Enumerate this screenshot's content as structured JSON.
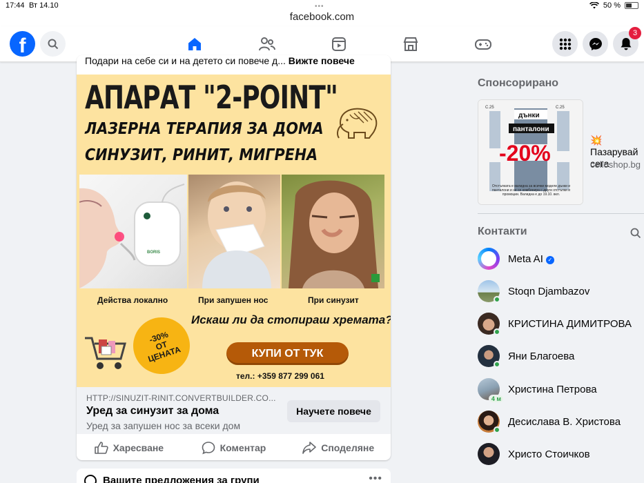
{
  "status_bar": {
    "time": "17:44",
    "date": "Вт 14.10",
    "url": "facebook.com",
    "battery": "50 %"
  },
  "header": {
    "notification_count": "3"
  },
  "post": {
    "caption_text": "Подари на себе си и на детето си повече д...",
    "caption_more": "Вижте повече",
    "ad": {
      "title": "АПАРАТ \"2-POINT\"",
      "subtitle1": "ЛАЗЕРНА ТЕРАПИЯ ЗА ДОМА",
      "subtitle2": "СИНУЗИТ, РИНИТ, МИГРЕНА",
      "caption1": "Действа локално",
      "caption2": "При запушен нос",
      "caption3": "При синузит",
      "question": "Искаш ли да стопираш хремата?",
      "discount_line1": "-30%",
      "discount_line2": "ОТ",
      "discount_line3": "ЦЕНАТА",
      "buy_label": "КУПИ ОТ ТУК",
      "phone": "тел.: +359 877 299 061",
      "device_label": "BORIS"
    },
    "link_url": "HTTP://SINUZIT-RINIT.CONVERTBUILDER.CO...",
    "link_title": "Уред за синузит за дома",
    "link_desc": "Уред за запушен нос за всеки дом",
    "learn_more": "Научете повече",
    "actions": {
      "like": "Харесване",
      "comment": "Коментар",
      "share": "Споделяне"
    }
  },
  "post2": {
    "title": "Вашите предложения за групи"
  },
  "sidebar": {
    "sponsored_title": "Спонсорирано",
    "sponsored": {
      "text": "💥 Пазарувай сега",
      "source": "celioshop.bg",
      "img_tag1": "дънки",
      "img_tag2": "панталони",
      "img_discount": "-20%",
      "img_fineprint": "Отстъпката е валидна за всички модели дънки и панталони и не се комбинира с други отстъпки и промоции. Валидна е до 19.10. вкл.",
      "img_price": "C.25"
    },
    "contacts_title": "Контакти",
    "contacts": [
      {
        "name": "Meta AI"
      },
      {
        "name": "Stoqn Djambazov"
      },
      {
        "name": "КРИСТИНА ДИМИТРОВА"
      },
      {
        "name": "Яни Благоева"
      },
      {
        "name": "Христина Петрова",
        "ago": "4 м"
      },
      {
        "name": "Десислава В. Христова"
      },
      {
        "name": "Христо Стоичков"
      }
    ]
  },
  "colors": {
    "fb_blue": "#0866ff",
    "ad_background": "#fde3a0",
    "buy_button": "#b55a08",
    "online_green": "#31a24c",
    "badge_red": "#e41e3f"
  }
}
